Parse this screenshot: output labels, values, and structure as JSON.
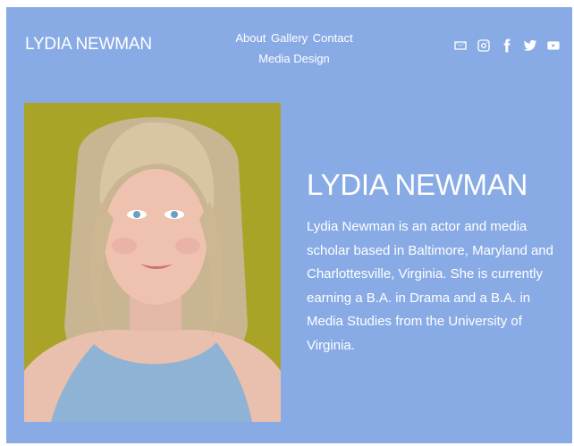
{
  "header": {
    "site_title": "LYDIA NEWMAN",
    "nav": [
      {
        "label": "About"
      },
      {
        "label": "Gallery"
      },
      {
        "label": "Contact"
      },
      {
        "label": "Media Design"
      }
    ],
    "social_icons": [
      "mail-icon",
      "instagram-icon",
      "facebook-icon",
      "twitter-icon",
      "youtube-icon"
    ]
  },
  "hero": {
    "heading": "LYDIA NEWMAN",
    "bio": "Lydia Newman is an actor and media scholar based in Baltimore, Maryland and Charlottesville, Virginia. She is currently earning a B.A. in Drama and a B.A. in Media Studies from the University of Virginia."
  },
  "colors": {
    "background": "#89abe5",
    "text": "#ffffff",
    "photo_backdrop": "#a9a428"
  }
}
